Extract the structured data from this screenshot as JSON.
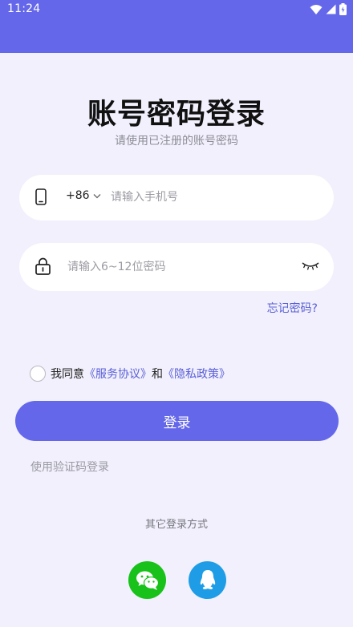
{
  "status_bar": {
    "time": "11:24"
  },
  "header": {
    "title": "账号密码登录",
    "subtitle": "请使用已注册的账号密码"
  },
  "phone_field": {
    "country_code": "+86",
    "value": "",
    "placeholder": "请输入手机号"
  },
  "password_field": {
    "value": "",
    "placeholder": "请输入6~12位密码"
  },
  "forgot_password": "忘记密码?",
  "agreement": {
    "prefix": "我同意",
    "service_link": "《服务协议》",
    "conjunction": "和",
    "privacy_link": "《隐私政策》",
    "checked": false
  },
  "login_button": "登录",
  "sms_login": "使用验证码登录",
  "other_login": {
    "title": "其它登录方式",
    "methods": [
      {
        "icon": "wechat-icon",
        "color": "#18c21a"
      },
      {
        "icon": "qq-icon",
        "color": "#1e9de6"
      }
    ]
  },
  "colors": {
    "accent": "#6467e9",
    "background": "#f1f0fc",
    "link": "#5a5fd8"
  }
}
